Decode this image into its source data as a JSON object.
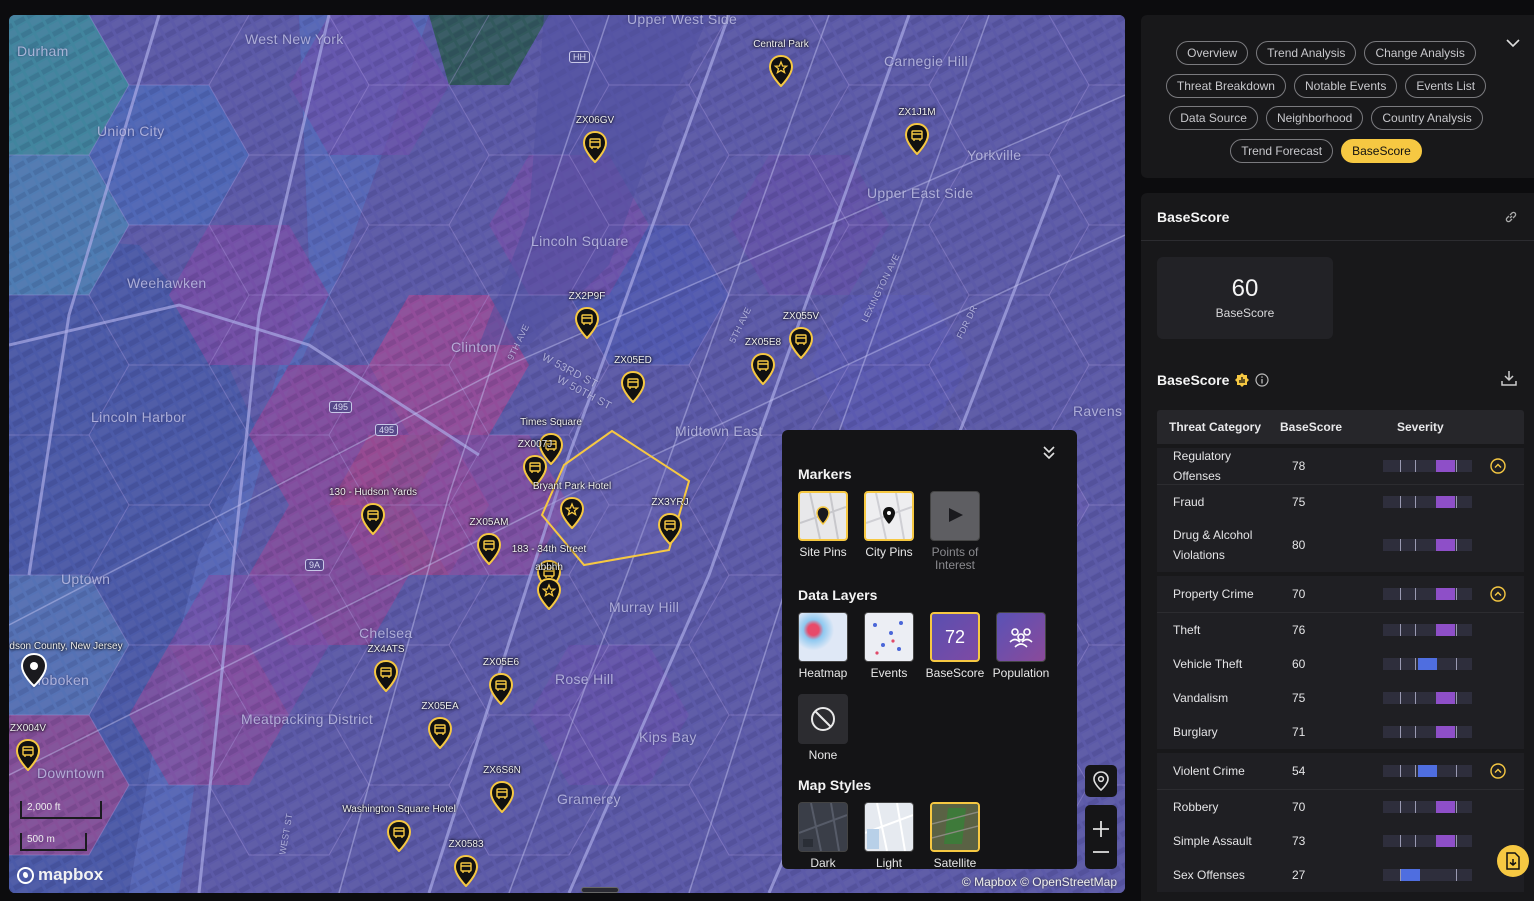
{
  "colors": {
    "accent": "#f6c842",
    "panel_bg": "#18181a",
    "severity_high": "#8e4fc8",
    "severity_low": "#4f6ee0"
  },
  "map": {
    "place_labels": [
      "Durham",
      "West New York",
      "Upper West Side",
      "Carnegie Hill",
      "Union City",
      "Yorkville",
      "Upper East Side",
      "Lincoln Square",
      "Weehawken",
      "Clinton",
      "W 53RD ST",
      "W 50TH ST",
      "Lincoln Harbor",
      "Midtown East",
      "Ravens",
      "Murray Hill",
      "Uptown",
      "Chelsea",
      "Rose Hill",
      "Meatpacking District",
      "Kips Bay",
      "Gramercy",
      "Downtown",
      "Hoboken",
      "Bryant Park Hotel",
      "9TH AVE",
      "5TH AVE",
      "LEXINGTON AVE",
      "FDR DR",
      "WEST ST"
    ],
    "road_shields": [
      "HH",
      "495",
      "495",
      "9A"
    ],
    "pins": [
      {
        "label": "Central Park",
        "type": "poi"
      },
      {
        "label": "ZX06GV",
        "type": "site"
      },
      {
        "label": "ZX1J1M",
        "type": "site"
      },
      {
        "label": "ZX2P9F",
        "type": "site"
      },
      {
        "label": "ZX055V",
        "type": "site"
      },
      {
        "label": "ZX05E8",
        "type": "site"
      },
      {
        "label": "ZX05ED",
        "type": "site"
      },
      {
        "label": "Times Square",
        "type": "site"
      },
      {
        "label": "ZX007J",
        "type": "site"
      },
      {
        "label": "Bryant Park Hotel",
        "type": "poi"
      },
      {
        "label": "130 - Hudson Yards",
        "type": "site"
      },
      {
        "label": "ZX3YRJ",
        "type": "site"
      },
      {
        "label": "ZX05AM",
        "type": "site"
      },
      {
        "label": "183 - 34th Street",
        "type": "site"
      },
      {
        "label": "abbhh",
        "type": "poi"
      },
      {
        "label": "ZX4ATS",
        "type": "site"
      },
      {
        "label": "ZX05E6",
        "type": "site"
      },
      {
        "label": "ZX05EA",
        "type": "site"
      },
      {
        "label": "ZX004V",
        "type": "site"
      },
      {
        "label": "ZX6S6N",
        "type": "site"
      },
      {
        "label": "Washington Square Hotel",
        "type": "site"
      },
      {
        "label": "ZX0583",
        "type": "site"
      },
      {
        "label": "Hudson County, New Jersey",
        "type": "city"
      }
    ],
    "city_label_visible": "dson County, New Jersey",
    "scale": {
      "ft": "2,000 ft",
      "m": "500 m"
    },
    "logo": "mapbox",
    "attribution": "© Mapbox  © OpenStreetMap"
  },
  "layers_popup": {
    "markers_heading": "Markers",
    "markers": [
      {
        "label": "Site Pins",
        "selected": true,
        "enabled": true
      },
      {
        "label": "City Pins",
        "selected": true,
        "enabled": true
      },
      {
        "label": "Points of Interest",
        "selected": false,
        "enabled": false
      }
    ],
    "data_layers_heading": "Data Layers",
    "data_layers": [
      {
        "label": "Heatmap",
        "selected": false
      },
      {
        "label": "Events",
        "selected": false
      },
      {
        "label": "BaseScore",
        "selected": true,
        "thumb_value": "72"
      },
      {
        "label": "Population",
        "selected": false
      },
      {
        "label": "None",
        "selected": false
      }
    ],
    "map_styles_heading": "Map Styles",
    "map_styles": [
      {
        "label": "Dark",
        "selected": false
      },
      {
        "label": "Light",
        "selected": false
      },
      {
        "label": "Satellite",
        "selected": true
      }
    ]
  },
  "tabs": {
    "row1": [
      "Overview",
      "Trend Analysis",
      "Change Analysis"
    ],
    "row2": [
      "Threat Breakdown",
      "Notable Events",
      "Events List"
    ],
    "row3": [
      "Data Source",
      "Neighborhood",
      "Country Analysis"
    ],
    "row4": [
      "Trend Forecast",
      "BaseScore"
    ],
    "active": "BaseScore"
  },
  "basescore": {
    "title": "BaseScore",
    "score_value": "60",
    "score_label": "BaseScore",
    "section_title": "BaseScore",
    "table": {
      "headers": [
        "Threat Category",
        "BaseScore",
        "Severity"
      ],
      "groups": [
        {
          "name": "Regulatory Offenses",
          "score": 78,
          "children": [
            {
              "name": "Fraud",
              "score": 75
            },
            {
              "name": "Drug & Alcohol Violations",
              "score": 80
            }
          ]
        },
        {
          "name": "Property Crime",
          "score": 70,
          "children": [
            {
              "name": "Theft",
              "score": 76
            },
            {
              "name": "Vehicle Theft",
              "score": 60
            },
            {
              "name": "Vandalism",
              "score": 75
            },
            {
              "name": "Burglary",
              "score": 71
            }
          ]
        },
        {
          "name": "Violent Crime",
          "score": 54,
          "children": [
            {
              "name": "Robbery",
              "score": 70
            },
            {
              "name": "Simple Assault",
              "score": 73
            },
            {
              "name": "Sex Offenses",
              "score": 27
            }
          ]
        }
      ]
    }
  }
}
